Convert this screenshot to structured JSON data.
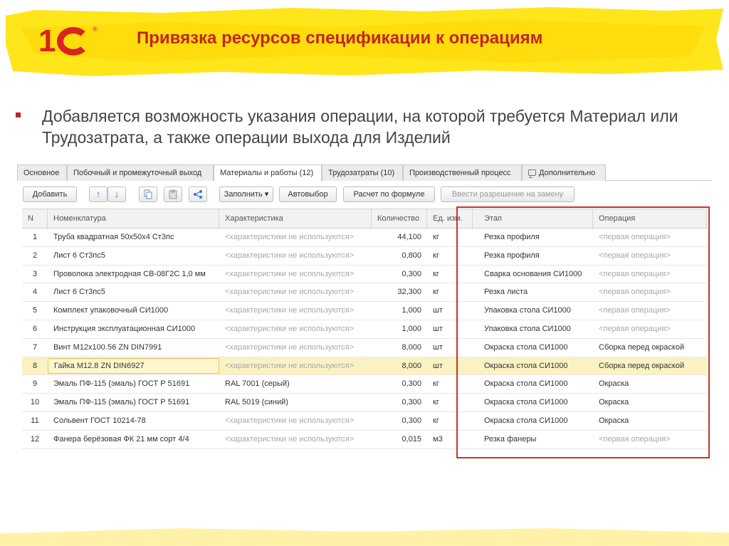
{
  "slide": {
    "title": "Привязка ресурсов спецификации к операциям",
    "bullet": "Добавляется возможность указания операции, на которой требуется Материал или Трудозатрата, а также операции выхода для Изделий",
    "logo": {
      "text_1": "1",
      "reg": "®"
    }
  },
  "colors": {
    "accent_red": "#c0251e",
    "highlight_yellow": "#ffe61a",
    "selected_row": "#fbf2c4"
  },
  "tabs": [
    {
      "label": "Основное"
    },
    {
      "label": "Побочный и промежуточный выход"
    },
    {
      "label": "Материалы и работы (12)",
      "active": true
    },
    {
      "label": "Трудозатраты (10)"
    },
    {
      "label": "Производственный процесс"
    },
    {
      "label": "Дополнительно",
      "icon": "comment-icon"
    }
  ],
  "toolbar": {
    "add": "Добавить",
    "move_up_icon": "↑",
    "move_down_icon": "↓",
    "copy_icon": "copy-icon",
    "paste_icon": "paste-icon",
    "structure_icon": "structure-icon",
    "fill": "Заполнить",
    "fill_caret": "▾",
    "autoselect": "Автовыбор",
    "formula": "Расчет по формуле",
    "replace": "Ввести разрешение на замену"
  },
  "table": {
    "columns": [
      "N",
      "Номенклатура",
      "Характеристика",
      "Количество",
      "Ед. изм.",
      "Этап",
      "Операция"
    ],
    "rows": [
      {
        "n": "1",
        "nom": "Труба квадратная 50х50х4 Ст3пс",
        "char": "<характеристики не используются>",
        "char_muted": true,
        "qty": "44,100",
        "unit": "кг",
        "stage": "Резка профиля",
        "op": "<первая операция>",
        "op_muted": true
      },
      {
        "n": "2",
        "nom": "Лист 6 Ст3пс5",
        "char": "<характеристики не используются>",
        "char_muted": true,
        "qty": "0,800",
        "unit": "кг",
        "stage": "Резка профиля",
        "op": "<первая операция>",
        "op_muted": true
      },
      {
        "n": "3",
        "nom": "Проволока электродная СВ-08Г2С 1,0 мм",
        "char": "<характеристики не используются>",
        "char_muted": true,
        "qty": "0,300",
        "unit": "кг",
        "stage": "Сварка основания СИ1000",
        "op": "<первая операция>",
        "op_muted": true
      },
      {
        "n": "4",
        "nom": "Лист 6 Ст3пс5",
        "char": "<характеристики не используются>",
        "char_muted": true,
        "qty": "32,300",
        "unit": "кг",
        "stage": "Резка листа",
        "op": "<первая операция>",
        "op_muted": true
      },
      {
        "n": "5",
        "nom": "Комплект упаковочный СИ1000",
        "char": "<характеристики не используются>",
        "char_muted": true,
        "qty": "1,000",
        "unit": "шт",
        "stage": "Упаковка стола СИ1000",
        "op": "<первая операция>",
        "op_muted": true
      },
      {
        "n": "6",
        "nom": "Инструкция эксплуатационная СИ1000",
        "char": "<характеристики не используются>",
        "char_muted": true,
        "qty": "1,000",
        "unit": "шт",
        "stage": "Упаковка стола СИ1000",
        "op": "<первая операция>",
        "op_muted": true
      },
      {
        "n": "7",
        "nom": "Винт М12х100.56 ZN DIN7991",
        "char": "<характеристики не используются>",
        "char_muted": true,
        "qty": "8,000",
        "unit": "шт",
        "stage": "Окраска стола СИ1000",
        "op": "Сборка перед окраской",
        "op_muted": false
      },
      {
        "n": "8",
        "nom": "Гайка М12.8 ZN DIN6927",
        "char": "<характеристики не используются>",
        "char_muted": true,
        "qty": "8,000",
        "unit": "шт",
        "stage": "Окраска стола СИ1000",
        "op": "Сборка перед окраской",
        "op_muted": false,
        "selected": true
      },
      {
        "n": "9",
        "nom": "Эмаль ПФ-115 (эмаль) ГОСТ Р 51691",
        "char": "RAL 7001 (серый)",
        "char_muted": false,
        "qty": "0,300",
        "unit": "кг",
        "stage": "Окраска стола СИ1000",
        "op": "Окраска",
        "op_muted": false
      },
      {
        "n": "10",
        "nom": "Эмаль ПФ-115 (эмаль) ГОСТ Р 51691",
        "char": "RAL 5019 (синий)",
        "char_muted": false,
        "qty": "0,300",
        "unit": "кг",
        "stage": "Окраска стола СИ1000",
        "op": "Окраска",
        "op_muted": false
      },
      {
        "n": "11",
        "nom": "Сольвент ГОСТ 10214-78",
        "char": "<характеристики не используются>",
        "char_muted": true,
        "qty": "0,300",
        "unit": "кг",
        "stage": "Окраска стола СИ1000",
        "op": "Окраска",
        "op_muted": false
      },
      {
        "n": "12",
        "nom": "Фанера берёзовая ФК 21 мм сорт 4/4",
        "char": "<характеристики не используются>",
        "char_muted": true,
        "qty": "0,015",
        "unit": "м3",
        "stage": "Резка фанеры",
        "op": "<первая операция>",
        "op_muted": true
      }
    ]
  }
}
